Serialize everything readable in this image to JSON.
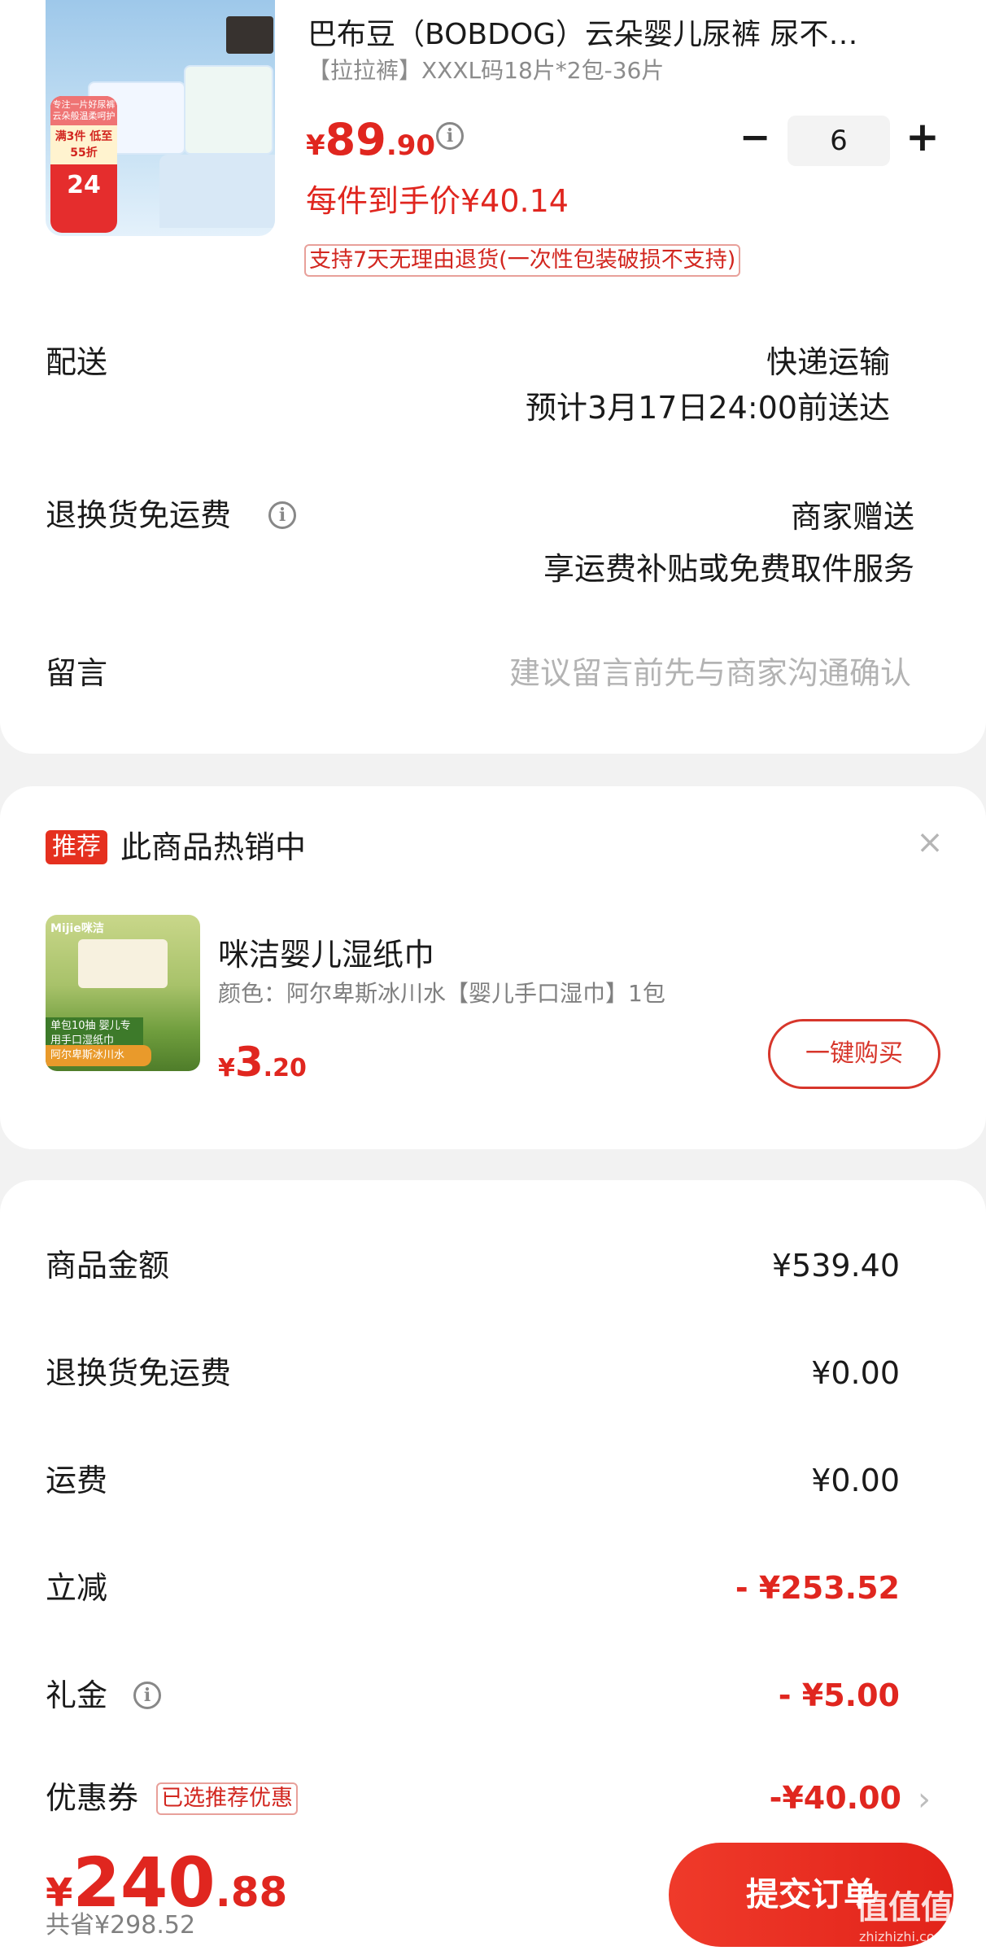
{
  "product": {
    "title": "巴布豆（BOBDOG）云朵婴儿尿裤 尿不…",
    "spec": "【拉拉裤】XXXL码18片*2包-36片",
    "price_currency": "¥",
    "price_int": "89",
    "price_dec": ".90",
    "per_item_price": "每件到手价¥40.14",
    "return_tag": "支持7天无理由退货(一次性包装破损不支持)",
    "quantity": "6",
    "minus": "−",
    "plus": "+",
    "image_badge": {
      "top": "专注一片好尿裤 云朵般温柔呵护",
      "mid": "满3件 低至55折",
      "num": "24"
    }
  },
  "delivery": {
    "label": "配送",
    "method": "快递运输",
    "eta": "预计3月17日24:00前送达"
  },
  "return_shipping": {
    "label": "退换货免运费",
    "value": "商家赠送",
    "detail": "享运费补贴或免费取件服务"
  },
  "message": {
    "label": "留言",
    "placeholder": "建议留言前先与商家沟通确认"
  },
  "recommendation": {
    "badge": "推荐",
    "title": "此商品热销中",
    "close": "×",
    "name": "咪洁婴儿湿纸巾",
    "spec": "颜色：阿尔卑斯冰川水【婴儿手口湿巾】1包",
    "price_currency": "¥",
    "price_int": "3",
    "price_dec": ".20",
    "buy_label": "一键购买",
    "image_text": {
      "logo": "Mijie咪洁",
      "label1": "单包10抽 婴儿专用手口湿纸巾",
      "label2": "阿尔卑斯冰川水"
    }
  },
  "summary": {
    "goods_label": "商品金额",
    "goods_value": "¥539.40",
    "return_label": "退换货免运费",
    "return_value": "¥0.00",
    "shipping_label": "运费",
    "shipping_value": "¥0.00",
    "discount_label": "立减",
    "discount_value": "- ¥253.52",
    "gift_label": "礼金",
    "gift_value": "- ¥5.00",
    "coupon_label": "优惠券",
    "coupon_tag": "已选推荐优惠",
    "coupon_value": "-¥40.00",
    "chevron": "›"
  },
  "footer": {
    "total_currency": "¥",
    "total_int": "240",
    "total_dec": ".88",
    "saved": "共省¥298.52",
    "submit_label": "提交订单",
    "watermark": "值值值",
    "watermark_sub": "zhizhizhi.com"
  },
  "colors": {
    "accent": "#e0261f",
    "background": "#f2f2f2",
    "card": "#ffffff"
  }
}
